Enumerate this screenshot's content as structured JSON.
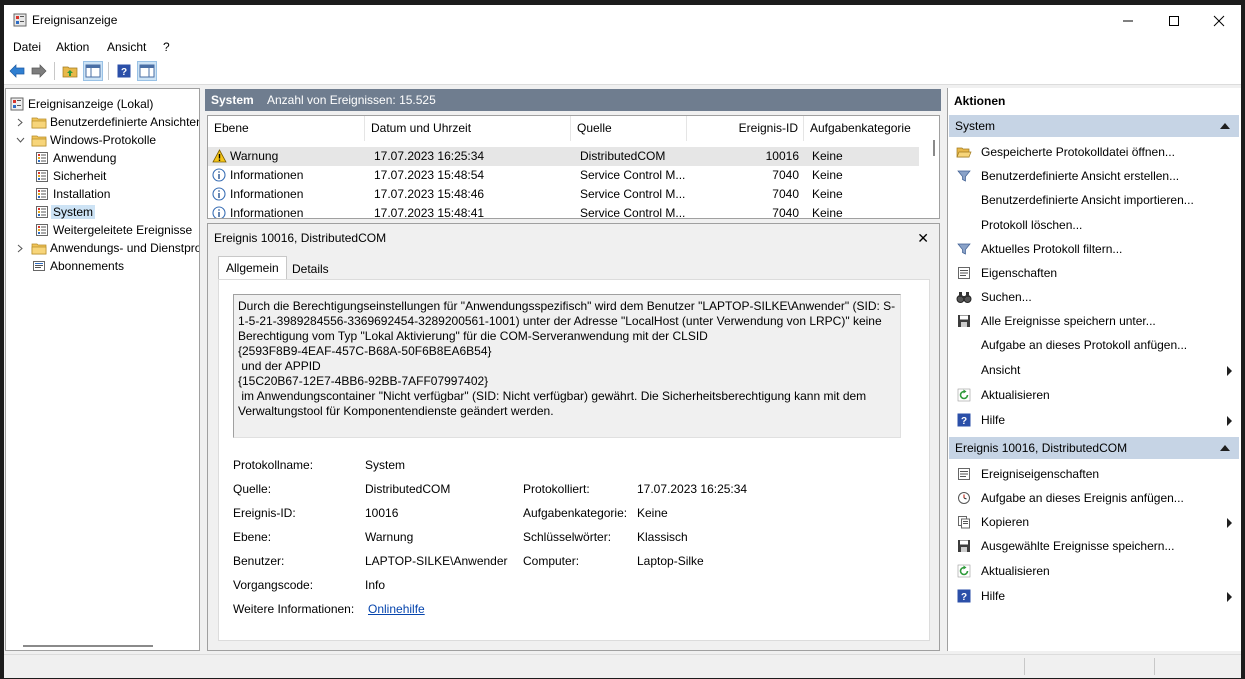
{
  "window": {
    "title": "Ereignisanzeige"
  },
  "menu": [
    "Datei",
    "Aktion",
    "Ansicht",
    "?"
  ],
  "tree": [
    {
      "label": "Ereignisanzeige (Lokal)",
      "expander": "",
      "icon": "viewer-icon"
    },
    {
      "label": "Benutzerdefinierte Ansichten",
      "expander": "right",
      "icon": "folder-icon"
    },
    {
      "label": "Windows-Protokolle",
      "expander": "down",
      "icon": "folder-icon"
    },
    {
      "label": "Anwendung",
      "expander": "",
      "icon": "log-icon"
    },
    {
      "label": "Sicherheit",
      "expander": "",
      "icon": "log-icon"
    },
    {
      "label": "Installation",
      "expander": "",
      "icon": "log-icon"
    },
    {
      "label": "System",
      "expander": "",
      "icon": "log-icon",
      "selected": true
    },
    {
      "label": "Weitergeleitete Ereignisse",
      "expander": "",
      "icon": "log-icon"
    },
    {
      "label": "Anwendungs- und Dienstprotokolle",
      "expander": "right",
      "icon": "folder-icon"
    },
    {
      "label": "Abonnements",
      "expander": "",
      "icon": "subscription-icon"
    }
  ],
  "log_header": {
    "name": "System",
    "count": "Anzahl von Ereignissen: 15.525"
  },
  "columns": [
    "Ebene",
    "Datum und Uhrzeit",
    "Quelle",
    "Ereignis-ID",
    "Aufgabenkategorie"
  ],
  "events": [
    {
      "level": "Warnung",
      "icon": "warning-icon",
      "date": "17.07.2023 16:25:34",
      "source": "DistributedCOM",
      "id": "10016",
      "category": "Keine",
      "selected": true
    },
    {
      "level": "Informationen",
      "icon": "info-icon",
      "date": "17.07.2023 15:48:54",
      "source": "Service Control M...",
      "id": "7040",
      "category": "Keine"
    },
    {
      "level": "Informationen",
      "icon": "info-icon",
      "date": "17.07.2023 15:48:46",
      "source": "Service Control M...",
      "id": "7040",
      "category": "Keine"
    },
    {
      "level": "Informationen",
      "icon": "info-icon",
      "date": "17.07.2023 15:48:41",
      "source": "Service Control M...",
      "id": "7040",
      "category": "Keine"
    }
  ],
  "detail": {
    "title": "Ereignis 10016, DistributedCOM",
    "tabs": [
      "Allgemein",
      "Details"
    ],
    "message": "Durch die Berechtigungseinstellungen für \"Anwendungsspezifisch\" wird dem Benutzer \"LAPTOP-SILKE\\Anwender\" (SID: S-1-5-21-3989284556-3369692454-3289200561-1001) unter der Adresse \"LocalHost (unter Verwendung von LRPC)\" keine Berechtigung vom Typ \"Lokal Aktivierung\" für die COM-Serveranwendung mit der CLSID\n{2593F8B9-4EAF-457C-B68A-50F6B8EA6B54}\n und der APPID\n{15C20B67-12E7-4BB6-92BB-7AFF07997402}\n im Anwendungscontainer \"Nicht verfügbar\" (SID: Nicht verfügbar) gewährt. Die Sicherheitsberechtigung kann mit dem Verwaltungstool für Komponentendienste geändert werden.",
    "props": {
      "protokollname_label": "Protokollname:",
      "protokollname": "System",
      "quelle_label": "Quelle:",
      "quelle": "DistributedCOM",
      "protokolliert_label": "Protokolliert:",
      "protokolliert": "17.07.2023 16:25:34",
      "id_label": "Ereignis-ID:",
      "id": "10016",
      "kategorie_label": "Aufgabenkategorie:",
      "kategorie": "Keine",
      "ebene_label": "Ebene:",
      "ebene": "Warnung",
      "schluessel_label": "Schlüsselwörter:",
      "schluessel": "Klassisch",
      "benutzer_label": "Benutzer:",
      "benutzer": "LAPTOP-SILKE\\Anwender",
      "computer_label": "Computer:",
      "computer": "Laptop-Silke",
      "vorgang_label": "Vorgangscode:",
      "vorgang": "Info",
      "weitere_label": "Weitere Informationen:",
      "weitere_link": "Onlinehilfe"
    }
  },
  "actions": {
    "header": "Aktionen",
    "section1": {
      "title": "System",
      "items": [
        {
          "label": "Gespeicherte Protokolldatei öffnen...",
          "icon": "open-folder-icon"
        },
        {
          "label": "Benutzerdefinierte Ansicht erstellen...",
          "icon": "filter-icon"
        },
        {
          "label": "Benutzerdefinierte Ansicht importieren...",
          "icon": ""
        },
        {
          "label": "Protokoll löschen...",
          "icon": ""
        },
        {
          "label": "Aktuelles Protokoll filtern...",
          "icon": "filter-icon"
        },
        {
          "label": "Eigenschaften",
          "icon": "properties-icon"
        },
        {
          "label": "Suchen...",
          "icon": "binoculars-icon"
        },
        {
          "label": "Alle Ereignisse speichern unter...",
          "icon": "save-icon"
        },
        {
          "label": "Aufgabe an dieses Protokoll anfügen...",
          "icon": ""
        },
        {
          "label": "Ansicht",
          "icon": "",
          "submenu": true
        },
        {
          "label": "Aktualisieren",
          "icon": "refresh-icon"
        },
        {
          "label": "Hilfe",
          "icon": "help-icon",
          "submenu": true
        }
      ]
    },
    "section2": {
      "title": "Ereignis 10016, DistributedCOM",
      "items": [
        {
          "label": "Ereigniseigenschaften",
          "icon": "properties-icon"
        },
        {
          "label": "Aufgabe an dieses Ereignis anfügen...",
          "icon": "task-icon"
        },
        {
          "label": "Kopieren",
          "icon": "copy-icon",
          "submenu": true
        },
        {
          "label": "Ausgewählte Ereignisse speichern...",
          "icon": "save-icon"
        },
        {
          "label": "Aktualisieren",
          "icon": "refresh-icon"
        },
        {
          "label": "Hilfe",
          "icon": "help-icon",
          "submenu": true
        }
      ]
    }
  },
  "colors": {
    "section_header": "#c6d4e5",
    "log_header": "#6f7d8f",
    "selection": "#cde3f5",
    "link": "#0645ad"
  }
}
